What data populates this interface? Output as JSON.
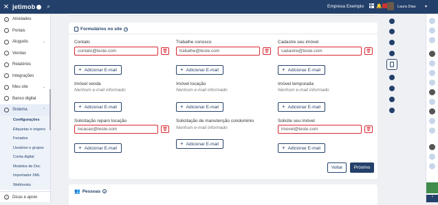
{
  "topbar": {
    "brand": "jetimob",
    "company": "Empresa Exemplo",
    "user_name": "Laura Dias"
  },
  "sidebar": {
    "items": [
      {
        "label": "Atividades",
        "icon": "check-circle-icon"
      },
      {
        "label": "Portais",
        "icon": "portal-icon"
      },
      {
        "label": "Aluguéis",
        "icon": "key-icon",
        "chevron": true
      },
      {
        "label": "Vendas",
        "icon": "cart-icon"
      },
      {
        "label": "Relatórios",
        "icon": "report-icon"
      },
      {
        "label": "Integrações",
        "icon": "plug-icon"
      },
      {
        "label": "Meu site",
        "icon": "globe-icon",
        "chevron": true
      },
      {
        "label": "Banco digital",
        "icon": "bank-icon"
      },
      {
        "label": "Sistema",
        "icon": "monitor-icon",
        "chevron": true,
        "active": true
      }
    ],
    "subitems": [
      {
        "label": "Configurações",
        "current": true
      },
      {
        "label": "Etiquetas e origens"
      },
      {
        "label": "Feriados"
      },
      {
        "label": "Usuários e grupos"
      },
      {
        "label": "Conta digital"
      },
      {
        "label": "Modelos de Doc"
      },
      {
        "label": "Importador XML"
      },
      {
        "label": "Webhooks"
      }
    ],
    "footer": "Dicas e apoio"
  },
  "forms_card": {
    "title": "Formulários no site",
    "add_label": "Adicionar E-mail",
    "fields": [
      {
        "label": "Contato",
        "value": "contato@teste.com"
      },
      {
        "label": "Trabalhe conosco",
        "value": "trabalhe@teste.com"
      },
      {
        "label": "Cadastre seu imóvel",
        "value": "cadastre@teste.com"
      },
      {
        "label": "Imóvel venda",
        "empty": "Nenhum e-mail informado"
      },
      {
        "label": "Imóvel locação",
        "empty": "Nenhum e-mail informado"
      },
      {
        "label": "Imóvel temporada",
        "empty": "Nenhum e-mail informado"
      },
      {
        "label": "Solicitação reparo locação",
        "value": "locacao@teste.com"
      },
      {
        "label": "Solicitação de manutenção condominio",
        "empty": "Nenhum e-mail informado"
      },
      {
        "label": "Solicite seu imóvel",
        "value": "imovel@teste.com"
      }
    ],
    "back_label": "Voltar",
    "next_label": "Próximo"
  },
  "people_card": {
    "title": "Pessoas"
  }
}
